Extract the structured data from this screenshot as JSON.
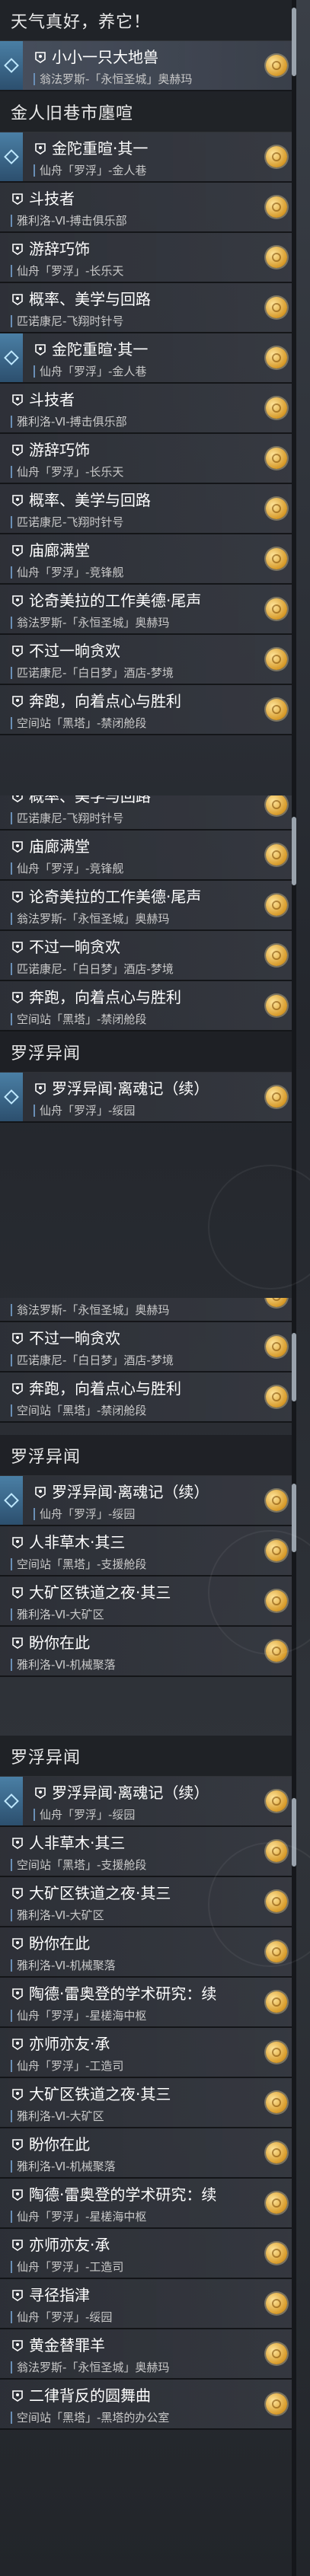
{
  "items": {
    "tianqi": {
      "title": "天气真好，养它！"
    },
    "xiaoxiao": {
      "title": "小小一只大地兽",
      "location": "翁法罗斯-「永恒圣城」奥赫玛"
    },
    "jinrenjiushi": {
      "title": "金人旧巷市廛喧"
    },
    "jintuo": {
      "title": "金陀重暄·其一",
      "location": "仙舟「罗浮」-金人巷"
    },
    "doujizhe": {
      "title": "斗技者",
      "location": "雅利洛-Ⅵ-搏击俱乐部"
    },
    "youci": {
      "title": "游辞巧饰",
      "location": "仙舟「罗浮」-长乐天"
    },
    "gailv": {
      "title": "概率、美学与回路",
      "location": "匹诺康尼-飞翔时针号"
    },
    "tanglang": {
      "title": "庙廊满堂",
      "location": "仙舟「罗浮」-竞锋舰"
    },
    "lunqi": {
      "title": "论奇美拉的工作美德·尾声",
      "location": "翁法罗斯-「永恒圣城」奥赫玛"
    },
    "buguo": {
      "title": "不过一晌贪欢",
      "location": "匹诺康尼-「白日梦」酒店-梦境"
    },
    "benpao": {
      "title": "奔跑，向着点心与胜利",
      "location": "空间站「黑塔」-禁闭舱段"
    },
    "luofuyiwen": {
      "title": "罗浮异闻"
    },
    "luofuli": {
      "title": "罗浮异闻·离魂记（续）",
      "location": "仙舟「罗浮」-绥园"
    },
    "renfei": {
      "title": "人非草木·其三",
      "location": "空间站「黑塔」-支援舱段"
    },
    "dakuang": {
      "title": "大矿区铁道之夜·其三",
      "location": "雅利洛-Ⅵ-大矿区"
    },
    "panni": {
      "title": "盼你在此",
      "location": "雅利洛-Ⅵ-机械聚落"
    },
    "taode": {
      "title": "陶德·雷奥登的学术研究：续",
      "location": "仙舟「罗浮」-星槎海中枢"
    },
    "yishi": {
      "title": "亦师亦友·承",
      "location": "仙舟「罗浮」-工造司"
    },
    "xunjing": {
      "title": "寻径指津",
      "location": "仙舟「罗浮」-绥园"
    },
    "huangjin": {
      "title": "黄金替罪羊",
      "location": "翁法罗斯-「永恒圣城」奥赫玛"
    },
    "erlv": {
      "title": "二律背反的圆舞曲",
      "location": "空间站「黑塔」-黑塔的办公室"
    }
  }
}
